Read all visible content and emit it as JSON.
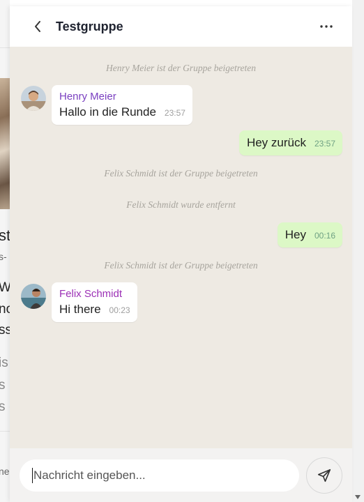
{
  "header": {
    "title": "Testgruppe"
  },
  "messages": {
    "sys1": "Henry Meier ist der Gruppe beigetreten",
    "henry": {
      "sender": "Henry Meier",
      "text": "Hallo in die Runde",
      "time": "23:57",
      "sender_color": "#7a3fc0"
    },
    "out1": {
      "text": "Hey zurück",
      "time": "23:57"
    },
    "sys2": "Felix Schmidt ist der Gruppe beigetreten",
    "sys3": "Felix Schmidt wurde entfernt",
    "out2": {
      "text": "Hey",
      "time": "00:16"
    },
    "sys4": "Felix Schmidt ist der Gruppe beigetreten",
    "felix": {
      "sender": "Felix Schmidt",
      "text": "Hi there",
      "time": "00:23",
      "sender_color": "#9b2fb5"
    }
  },
  "composer": {
    "placeholder": "Nachricht eingeben..."
  },
  "background": {
    "t1": "st",
    "t2": "s-",
    "t3": "We",
    "t4": "no",
    "t5": "ss",
    "t6": "is",
    "t7": "s",
    "t8": "s (",
    "t9": "ne"
  },
  "colors": {
    "chat_bg": "#eeeae3",
    "outgoing_bubble": "#dcf8c6",
    "incoming_bubble": "#ffffff"
  },
  "icons": {
    "back": "chevron-left-icon",
    "more": "more-horizontal-icon",
    "send": "send-icon"
  }
}
